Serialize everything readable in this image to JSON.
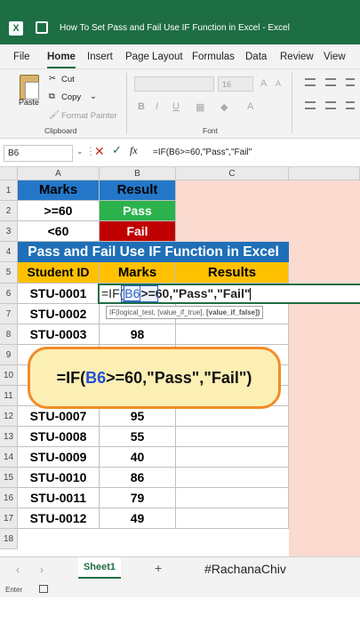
{
  "window": {
    "title": "How To Set Pass and Fail Use IF Function in Excel  -  Excel",
    "app_badge": "X"
  },
  "menu": {
    "tabs": [
      "File",
      "Home",
      "Insert",
      "Page Layout",
      "Formulas",
      "Data",
      "Review",
      "View"
    ],
    "active": "Home"
  },
  "ribbon": {
    "paste": "Paste",
    "cut": "Cut",
    "copy": "Copy",
    "format_painter": "Format Painter",
    "clipboard_group": "Clipboard",
    "font_size": "16",
    "font_group": "Font"
  },
  "formula_bar": {
    "name_box": "B6",
    "formula": "=IF(B6>=60,\"Pass\",\"Fail\"",
    "fx": "fx"
  },
  "columns": [
    "A",
    "B",
    "C"
  ],
  "rows": [
    "1",
    "2",
    "3",
    "4",
    "5",
    "6",
    "7",
    "8",
    "9",
    "10",
    "11",
    "12",
    "13",
    "14",
    "15",
    "16",
    "17",
    "18"
  ],
  "legend": {
    "h_marks": "Marks",
    "h_result": "Result",
    "cond_pass": ">=60",
    "pass": "Pass",
    "cond_fail": "<60",
    "fail": "Fail"
  },
  "banner": "Pass and Fail Use IF Function in Excel",
  "table_headers": {
    "id": "Student ID",
    "marks": "Marks",
    "results": "Results"
  },
  "editing": {
    "pre": "=IF(",
    "ref": "B6",
    "post": ">=60,\"Pass\",\"Fail\""
  },
  "students": [
    {
      "id": "STU-0001",
      "marks": ""
    },
    {
      "id": "STU-0002",
      "marks": ""
    },
    {
      "id": "STU-0003",
      "marks": "98"
    },
    {
      "id": "",
      "marks": ""
    },
    {
      "id": "",
      "marks": ""
    },
    {
      "id": "",
      "marks": ""
    },
    {
      "id": "STU-0007",
      "marks": "95"
    },
    {
      "id": "STU-0008",
      "marks": "55"
    },
    {
      "id": "STU-0009",
      "marks": "40"
    },
    {
      "id": "STU-0010",
      "marks": "86"
    },
    {
      "id": "STU-0011",
      "marks": "79"
    },
    {
      "id": "STU-0012",
      "marks": "49"
    }
  ],
  "tooltip": {
    "text": "IF(logical_test, [value_if_true], ",
    "bold": "[value_if_false])"
  },
  "callout": {
    "pre": "=IF(",
    "ref": "B6",
    "post": ">=60,\"Pass\",\"Fail\")"
  },
  "sheet": {
    "tab": "Sheet1",
    "add": "+",
    "watermark": "#RachanaChiv"
  },
  "status": {
    "mode": "Enter"
  },
  "colors": {
    "accent": "#1e6e43",
    "header_blue": "#2477c8",
    "banner_blue": "#1f6fb8",
    "gold": "#ffc000",
    "pass_green": "#2bb24c",
    "fail_red": "#c00000",
    "peach": "#fbdad0",
    "callout_border": "#f28c28"
  }
}
